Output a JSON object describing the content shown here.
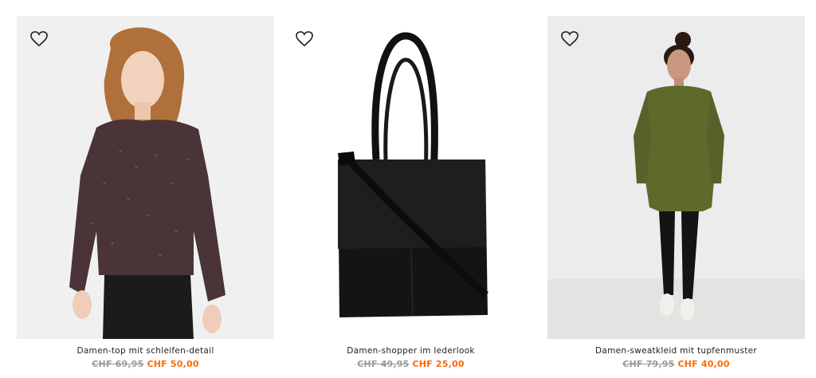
{
  "products": [
    {
      "name": "Damen-top mit schleifen-detail",
      "old_price": "CHF 69,95",
      "new_price": "CHF 50,00",
      "favorite_icon": "heart-outline-icon"
    },
    {
      "name": "Damen-shopper im lederlook",
      "old_price": "CHF 49,95",
      "new_price": "CHF 25,00",
      "favorite_icon": "heart-outline-icon"
    },
    {
      "name": "Damen-sweatkleid mit tupfenmuster",
      "old_price": "CHF 79,95",
      "new_price": "CHF 40,00",
      "favorite_icon": "heart-outline-icon"
    }
  ],
  "colors": {
    "sale_price": "#ff6a00",
    "old_price": "#9a9a9a",
    "text": "#222222"
  }
}
